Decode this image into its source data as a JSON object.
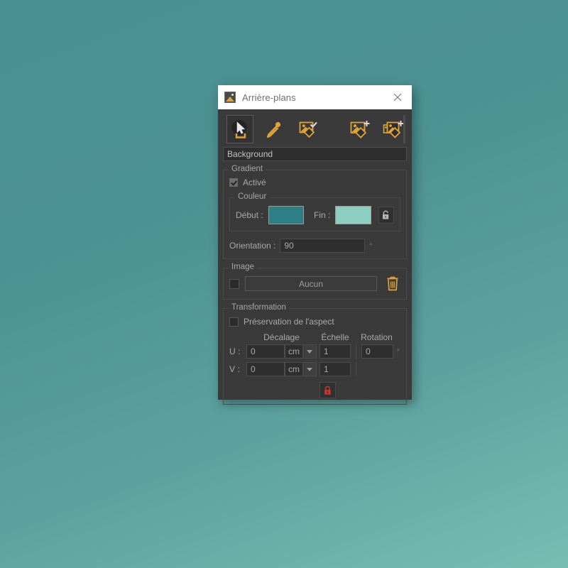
{
  "window": {
    "title": "Arrière-plans",
    "app_icon": "image-layer-icon",
    "close_label": "✕"
  },
  "toolbar": {
    "items": [
      {
        "name": "select-pick-tool",
        "icon": "cursor-select-icon",
        "selected": true
      },
      {
        "name": "eyedropper-tool",
        "icon": "eyedropper-icon",
        "selected": false
      },
      {
        "name": "apply-background-tool",
        "icon": "image-check-icon",
        "selected": false
      },
      {
        "name": "add-background-tool",
        "icon": "image-plus-icon",
        "selected": false
      },
      {
        "name": "add-background-layer-tool",
        "icon": "images-plus-icon",
        "selected": false
      }
    ]
  },
  "name_field": {
    "value": "Background",
    "placeholder": "Background"
  },
  "gradient": {
    "legend": "Gradient",
    "enabled_label": "Activé",
    "enabled": true,
    "couleur": {
      "legend": "Couleur",
      "start_label": "Début :",
      "start_color": "#2e7f85",
      "end_label": "Fin :",
      "end_color": "#8ecec0",
      "lock_icon": "unlocked-padlock-icon"
    },
    "orientation": {
      "label": "Orientation :",
      "value": "90",
      "unit": "°"
    }
  },
  "image": {
    "legend": "Image",
    "enabled": false,
    "button_label": "Aucun",
    "delete_icon": "trash-icon",
    "delete_color": "#e0a33c"
  },
  "transformation": {
    "legend": "Transformation",
    "preserve_aspect_label": "Préservation de l'aspect",
    "preserve_aspect": false,
    "columns": {
      "decalage": "Décalage",
      "echelle": "Échelle",
      "rotation": "Rotation"
    },
    "rows": [
      {
        "label": "U :",
        "offset": "0",
        "unit": "cm",
        "scale": "1",
        "rotation": "0",
        "rotation_unit": "°"
      },
      {
        "label": "V :",
        "offset": "0",
        "unit": "cm",
        "scale": "1",
        "rotation": null,
        "rotation_unit": null
      }
    ],
    "link_lock_icon": "locked-padlock-icon",
    "link_lock_color": "#c2372f"
  }
}
